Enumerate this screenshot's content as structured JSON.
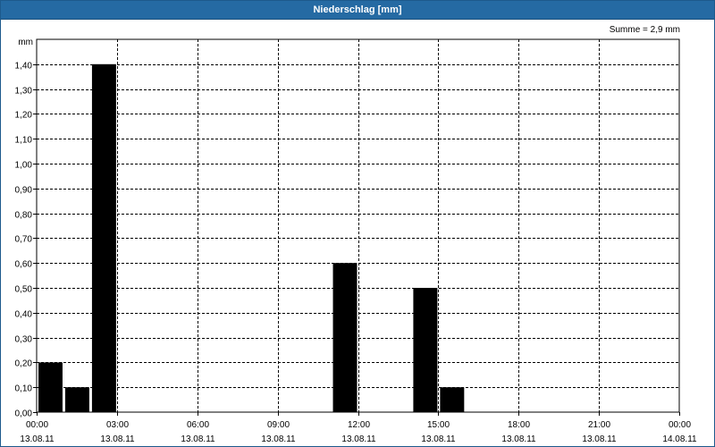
{
  "window": {
    "title": "Niederschlag [mm]"
  },
  "chart_data": {
    "type": "bar",
    "title": "Niederschlag [mm]",
    "ylabel": "mm",
    "annotation": "Summe = 2,9 mm",
    "ylim": [
      0,
      1.5
    ],
    "xlim_hours": [
      0,
      24
    ],
    "y_ticks": [
      "0,00",
      "0,10",
      "0,20",
      "0,30",
      "0,40",
      "0,50",
      "0,60",
      "0,70",
      "0,80",
      "0,90",
      "1,00",
      "1,10",
      "1,20",
      "1,30",
      "1,40"
    ],
    "x_ticks": [
      {
        "time": "00:00",
        "date": "13.08.11"
      },
      {
        "time": "03:00",
        "date": "13.08.11"
      },
      {
        "time": "06:00",
        "date": "13.08.11"
      },
      {
        "time": "09:00",
        "date": "13.08.11"
      },
      {
        "time": "12:00",
        "date": "13.08.11"
      },
      {
        "time": "15:00",
        "date": "13.08.11"
      },
      {
        "time": "18:00",
        "date": "13.08.11"
      },
      {
        "time": "21:00",
        "date": "13.08.11"
      },
      {
        "time": "00:00",
        "date": "14.08.11"
      }
    ],
    "bars": [
      {
        "time": "00:00–01:00",
        "value": 0.2
      },
      {
        "time": "01:00–02:00",
        "value": 0.1
      },
      {
        "time": "02:00–03:00",
        "value": 1.4
      },
      {
        "time": "11:00–12:00",
        "value": 0.6
      },
      {
        "time": "14:00–15:00",
        "value": 0.5
      },
      {
        "time": "15:00–16:00",
        "value": 0.1
      }
    ],
    "grid": true,
    "colors": {
      "bars": "#000000",
      "title_bar": "#256aa3",
      "grid": "#000000"
    }
  }
}
